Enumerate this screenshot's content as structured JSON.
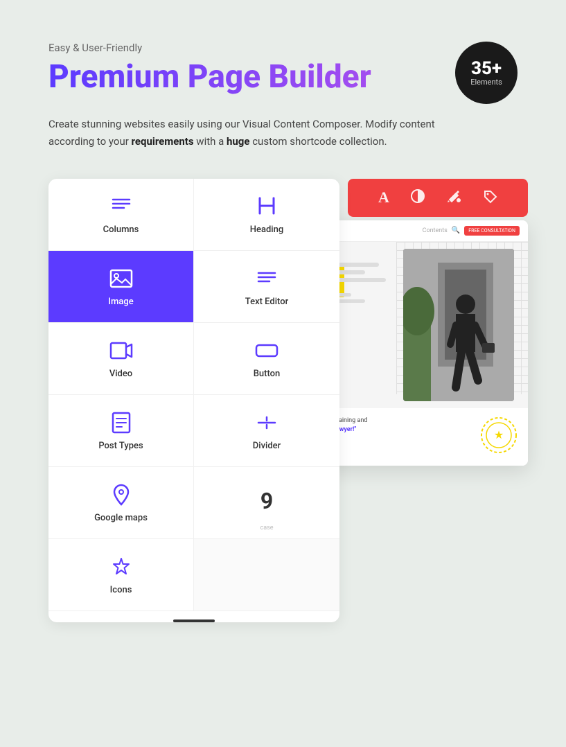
{
  "header": {
    "subtitle": "Easy &  User-Friendly",
    "title": "Premium Page Builder",
    "badge_number": "35+",
    "badge_text": "Elements"
  },
  "description": {
    "text_part1": "Create stunning websites easily using our Visual Content Composer. Modify content according to your ",
    "text_bold1": "requirements",
    "text_part2": " with a ",
    "text_bold2": "huge",
    "text_part3": " custom shortcode collection."
  },
  "elements": [
    {
      "id": "columns",
      "label": "Columns",
      "icon": "columns"
    },
    {
      "id": "heading",
      "label": "Heading",
      "icon": "heading"
    },
    {
      "id": "image",
      "label": "Image",
      "icon": "image",
      "active": true
    },
    {
      "id": "text-editor",
      "label": "Text Editor",
      "icon": "text-editor"
    },
    {
      "id": "video",
      "label": "Video",
      "icon": "video"
    },
    {
      "id": "button",
      "label": "Button",
      "icon": "button"
    },
    {
      "id": "post-types",
      "label": "Post Types",
      "icon": "post-types"
    },
    {
      "id": "divider",
      "label": "Divider",
      "icon": "divider"
    },
    {
      "id": "google-maps",
      "label": "Google maps",
      "icon": "google-maps"
    },
    {
      "id": "number",
      "label": "9",
      "icon": "number"
    },
    {
      "id": "icons",
      "label": "Icons",
      "icon": "icons"
    }
  ],
  "preview": {
    "nav_text": "Contents",
    "cta_text": "FREE CONSULTATION",
    "quote_text1": "e a lot of training and",
    "quote_text2": "tion as a lawyer!\""
  },
  "toolbar": {
    "icons": [
      "A",
      "◑",
      "🪣",
      "🏷"
    ]
  }
}
